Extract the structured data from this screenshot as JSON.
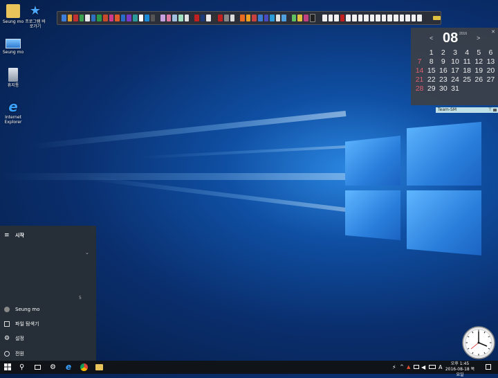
{
  "desktop": {
    "icons": [
      {
        "label": "Seung mo",
        "icon": "user-folder-icon"
      },
      {
        "label": "프로그램 바로가기",
        "icon": "star-shortcut-icon"
      },
      {
        "label": "Seung mo",
        "icon": "computer-icon"
      },
      {
        "label": "휴지통",
        "icon": "recycle-bin-icon"
      },
      {
        "label": "Internet Explorer",
        "icon": "internet-explorer-icon"
      }
    ]
  },
  "calendar": {
    "month": "08",
    "year": "2016",
    "prev": "<",
    "next": ">",
    "days": [
      "1",
      "2",
      "3",
      "4",
      "5",
      "6",
      "7",
      "8",
      "9",
      "10",
      "11",
      "12",
      "13",
      "14",
      "15",
      "16",
      "17",
      "18",
      "19",
      "20",
      "21",
      "22",
      "23",
      "24",
      "25",
      "26",
      "27",
      "28",
      "29",
      "30",
      "31"
    ],
    "widget_label": "Team-SM",
    "widget_pin": "⊤"
  },
  "start_menu": {
    "title": "시작",
    "count": "5",
    "items": [
      {
        "label": "Seung mo",
        "icon": "user-avatar-icon"
      },
      {
        "label": "파일 탐색기",
        "icon": "file-explorer-icon"
      },
      {
        "label": "설정",
        "icon": "gear-icon"
      },
      {
        "label": "전원",
        "icon": "power-icon"
      }
    ]
  },
  "taskbar": {
    "ime": "A",
    "time": "오후 1:45",
    "date": "2016-08-18 목요일"
  },
  "colors": {
    "toolbar_bg": "#2a2f3a",
    "calendar_bg": "#3c4048",
    "sunday": "#e06070",
    "startmenu_bg": "#283036",
    "taskbar_bg": "#101418"
  }
}
